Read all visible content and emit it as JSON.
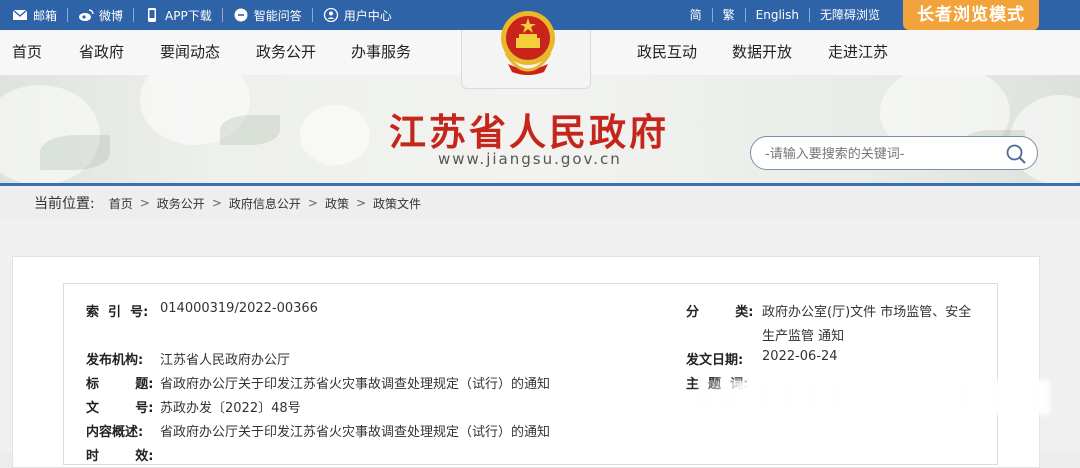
{
  "topbar": {
    "links": [
      {
        "icon": "mail-icon",
        "label": "邮箱"
      },
      {
        "icon": "weibo-icon",
        "label": "微博"
      },
      {
        "icon": "phone-icon",
        "label": "APP下载"
      },
      {
        "icon": "chat-icon",
        "label": "智能问答"
      },
      {
        "icon": "user-icon",
        "label": "用户中心"
      }
    ],
    "langs": [
      "简",
      "繁",
      "English",
      "无障碍浏览"
    ],
    "elder_mode": "长者浏览模式"
  },
  "nav": {
    "left": [
      "首页",
      "省政府",
      "要闻动态",
      "政务公开",
      "办事服务"
    ],
    "right": [
      "政民互动",
      "数据开放",
      "走进江苏"
    ]
  },
  "header": {
    "title": "江苏省人民政府",
    "url": "www.jiangsu.gov.cn",
    "search_placeholder": "-请输入要搜索的关键词-"
  },
  "breadcrumb": {
    "label": "当前位置:",
    "items": [
      "首页",
      "政务公开",
      "政府信息公开",
      "政策",
      "政策文件"
    ]
  },
  "info": {
    "index_label": "索  引  号:",
    "index_value": "014000319/2022-00366",
    "category_label": "分        类:",
    "category_value_1": "政府办公室(厅)文件 市场监管、安全",
    "category_value_2": "生产监管 通知",
    "issuer_label": "发布机构:",
    "issuer_value": "江苏省人民政府办公厅",
    "date_label": "发文日期:",
    "date_value": "2022-06-24",
    "title_label": "标        题:",
    "title_value": "省政府办公厅关于印发江苏省火灾事故调查处理规定（试行）的通知",
    "subject_label": "主  题  词:",
    "docno_label": "文        号:",
    "docno_value": "苏政办发〔2022〕48号",
    "summary_label": "内容概述:",
    "summary_value": "省政府办公厅关于印发江苏省火灾事故调查处理规定（试行）的通知",
    "validity_label": "时        效:"
  },
  "colors": {
    "topbar": "#2f63a8",
    "accent": "#f3a33c",
    "title_red": "#c5261c"
  }
}
